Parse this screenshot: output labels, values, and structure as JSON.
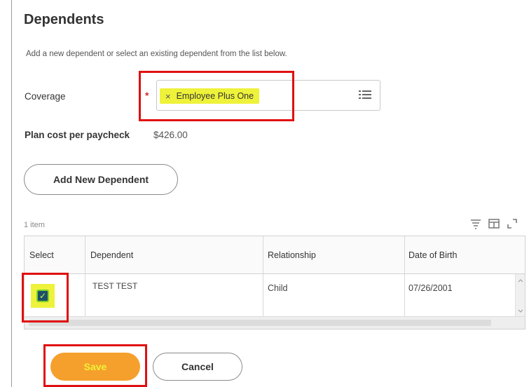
{
  "page": {
    "title": "Dependents",
    "subtitle": "Add a new dependent or select an existing dependent from the list below."
  },
  "coverage": {
    "label": "Coverage",
    "required_marker": "*",
    "selected_value": "Employee Plus One",
    "remove_glyph": "×",
    "icon": "list-icon"
  },
  "plan_cost": {
    "label": "Plan cost per paycheck",
    "value": "$426.00"
  },
  "add_dependent": {
    "label": "Add New Dependent"
  },
  "table": {
    "item_count": "1 item",
    "toolbar_icons": [
      "filter-icon",
      "columns-icon",
      "fullscreen-icon"
    ],
    "columns": [
      "Select",
      "Dependent",
      "Relationship",
      "Date of Birth"
    ],
    "rows": [
      {
        "selected": true,
        "dependent": "TEST TEST",
        "relationship": "Child",
        "date_of_birth": "07/26/2001"
      }
    ]
  },
  "actions": {
    "save_label": "Save",
    "cancel_label": "Cancel"
  },
  "colors": {
    "accent_orange": "#f5a02c",
    "highlight_yellow": "#eef23a",
    "annotation_red": "#e01010",
    "required_red": "#d32f2f"
  }
}
